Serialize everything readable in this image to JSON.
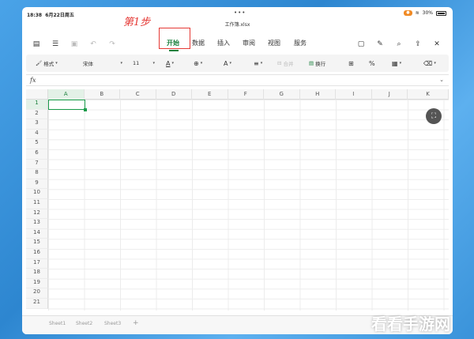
{
  "status": {
    "time": "18:38",
    "date": "6月22日周五",
    "battery": "30%"
  },
  "document": {
    "title": "工作簿.xlsx"
  },
  "annotation": "第1步",
  "tabs": [
    "开始",
    "数据",
    "插入",
    "审阅",
    "视图",
    "服务"
  ],
  "active_tab": "开始",
  "format": {
    "style_label": "格式",
    "font_name": "宋体",
    "font_size": "11",
    "merge_label": "合并",
    "wrap_label": "换行"
  },
  "formula_bar": {
    "label": "fx"
  },
  "columns": [
    "A",
    "B",
    "C",
    "D",
    "E",
    "F",
    "G",
    "H",
    "I",
    "J",
    "K"
  ],
  "rows": [
    "1",
    "2",
    "3",
    "4",
    "5",
    "6",
    "7",
    "8",
    "9",
    "10",
    "11",
    "12",
    "13",
    "14",
    "15",
    "16",
    "17",
    "18",
    "19",
    "20",
    "21"
  ],
  "selected_cell": "A1",
  "sheets": [
    "Sheet1",
    "Sheet2",
    "Sheet3"
  ],
  "watermark": "看看手游网",
  "colors": {
    "accent": "#1a7f3c",
    "highlight": "#e53935",
    "battery": "#f08a24"
  }
}
